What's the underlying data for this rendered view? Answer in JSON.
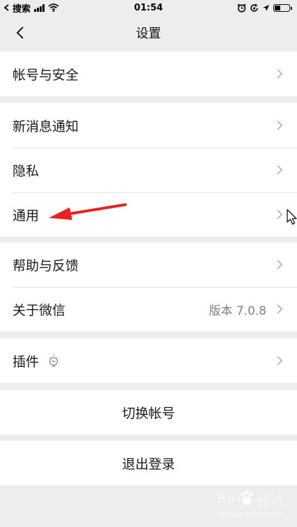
{
  "status_bar": {
    "carrier": "搜索",
    "time": "01:54"
  },
  "nav": {
    "title": "设置"
  },
  "sections": {
    "account": {
      "label": "帐号与安全"
    },
    "notifications": {
      "label": "新消息通知"
    },
    "privacy": {
      "label": "隐私"
    },
    "general": {
      "label": "通用"
    },
    "help": {
      "label": "帮助与反馈"
    },
    "about": {
      "label": "关于微信",
      "value": "版本 7.0.8"
    },
    "plugins": {
      "label": "插件"
    },
    "switch_account": {
      "label": "切换帐号"
    },
    "logout": {
      "label": "退出登录"
    }
  },
  "watermark": {
    "brand_a": "Bai",
    "brand_b": "经验",
    "url": "jingyan.baidu.com"
  },
  "colors": {
    "background": "#ededed",
    "card": "#ffffff",
    "annotation_arrow": "#e8231f"
  }
}
